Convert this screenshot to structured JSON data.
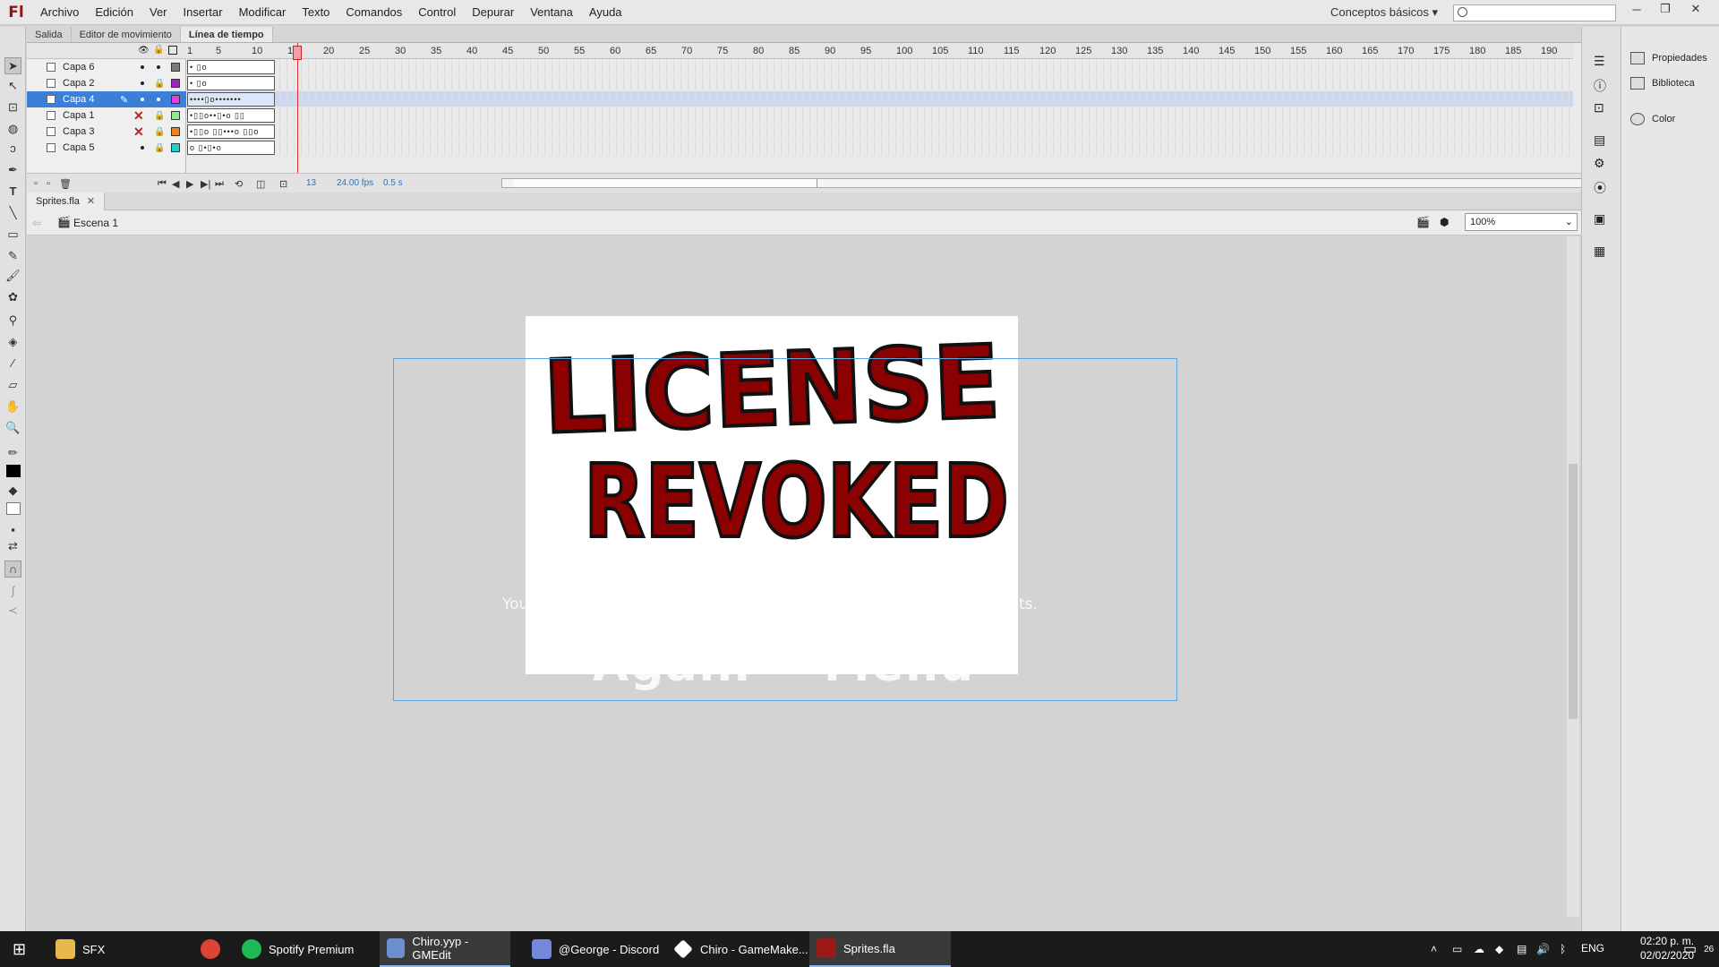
{
  "app": {
    "logo": "Fl",
    "menu": [
      "Archivo",
      "Edición",
      "Ver",
      "Insertar",
      "Modificar",
      "Texto",
      "Comandos",
      "Control",
      "Depurar",
      "Ventana",
      "Ayuda"
    ],
    "workspace": "Conceptos básicos"
  },
  "panel_tabs": [
    "Salida",
    "Editor de movimiento",
    "Línea de tiempo"
  ],
  "layers": [
    {
      "name": "Capa 6",
      "color": "#7a7a7a",
      "keys": "•    ▯o"
    },
    {
      "name": "Capa 2",
      "color": "#a020c0",
      "keys": "•    ▯o"
    },
    {
      "name": "Capa 4",
      "color": "#e040e0",
      "keys": "••••▯o•••••••"
    },
    {
      "name": "Capa 1",
      "color": "#90e890",
      "keys": "•▯▯o••▯•o     ▯▯"
    },
    {
      "name": "Capa 3",
      "color": "#f08020",
      "keys": "•▯▯o ▯▯•••o ▯▯o"
    },
    {
      "name": "Capa 5",
      "color": "#20d0d0",
      "keys": "o ▯•▯•o"
    }
  ],
  "ruler": [
    "1",
    "5",
    "10",
    "15",
    "20",
    "25",
    "30",
    "35",
    "40",
    "45",
    "50",
    "55",
    "60",
    "65",
    "70",
    "75",
    "80",
    "85",
    "90",
    "95",
    "100",
    "105",
    "110",
    "115",
    "120",
    "125",
    "130",
    "135",
    "140",
    "145",
    "150",
    "155",
    "160",
    "165",
    "170",
    "175",
    "180",
    "185",
    "190"
  ],
  "timeline_footer": {
    "frame": "13",
    "fps": "24.00 fps",
    "time": "0.5 s"
  },
  "document": {
    "tab": "Sprites.fla",
    "scene": "Escena 1",
    "zoom": "100%"
  },
  "stage": {
    "title_line1": "LICENSE",
    "title_line2": "REVOKED",
    "ghost_left": "You",
    "ghost_right": "ts.",
    "ghost_btn1": "Again",
    "ghost_btn2": "Menu",
    "title_color": "#8b0000"
  },
  "right_panel": [
    "Propiedades",
    "Biblioteca",
    "Color"
  ],
  "taskbar": {
    "items": [
      "SFX",
      "Spotify Premium",
      "Chiro.yyp - GMEdit",
      "@George - Discord",
      "Chiro - GameMake...",
      "Sprites.fla"
    ],
    "lang": "ENG",
    "time": "02:20 p. m.",
    "date": "02/02/2020",
    "notifications": "26"
  }
}
